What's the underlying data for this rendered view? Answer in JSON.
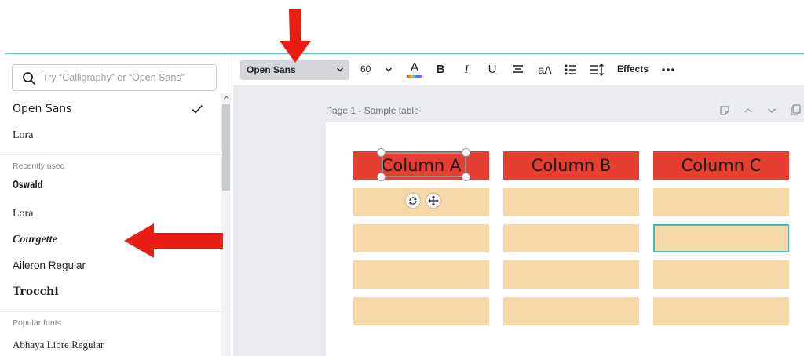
{
  "font_panel": {
    "search_placeholder": "Try “Calligraphy” or “Open Sans”",
    "top_fonts": [
      {
        "label": "Open Sans",
        "selected": true
      },
      {
        "label": "Lora"
      }
    ],
    "recently_used_label": "Recently used",
    "recently_used": [
      "Oswald",
      "Lora",
      "Courgette",
      "Aileron Regular",
      "Trocchi"
    ],
    "popular_label": "Popular fonts",
    "popular": [
      "Abhaya Libre Regular"
    ]
  },
  "toolbar": {
    "font_name": "Open Sans",
    "font_size": "60",
    "text_color_letter": "A",
    "bold_label": "B",
    "italic_label": "I",
    "underline_label": "U",
    "case_label": "aA",
    "effects_label": "Effects"
  },
  "canvas": {
    "page_title": "Page 1 - Sample table",
    "table": {
      "headers": [
        "Column A",
        "Column B",
        "Column C"
      ],
      "rows": [
        [
          "",
          "",
          ""
        ],
        [
          "",
          "",
          ""
        ],
        [
          "",
          "",
          ""
        ],
        [
          "",
          "",
          ""
        ]
      ]
    }
  },
  "colors": {
    "header_red": "#e43f30",
    "cell_tan": "#f6d8a8",
    "accent_teal": "#3cc1b9",
    "arrow_red": "#e81d14"
  }
}
